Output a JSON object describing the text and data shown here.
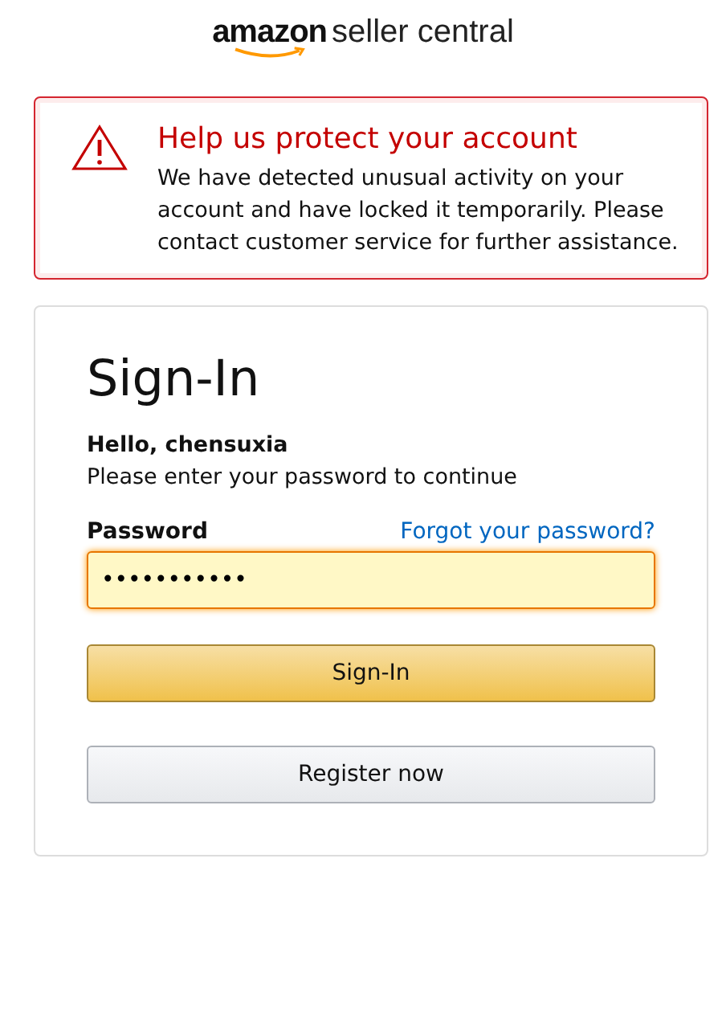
{
  "logo": {
    "brand": "amazon",
    "product": "seller central"
  },
  "alert": {
    "title": "Help us protect your account",
    "message": "We have detected unusual activity on your account and have locked it temporarily. Please contact customer service for further assistance."
  },
  "signin": {
    "heading": "Sign-In",
    "greeting": "Hello, chensuxia",
    "instruction": "Please enter your password to continue",
    "password_label": "Password",
    "forgot_link": "Forgot your password?",
    "password_value": "•••••••••••",
    "submit": "Sign-In",
    "register": "Register now"
  }
}
